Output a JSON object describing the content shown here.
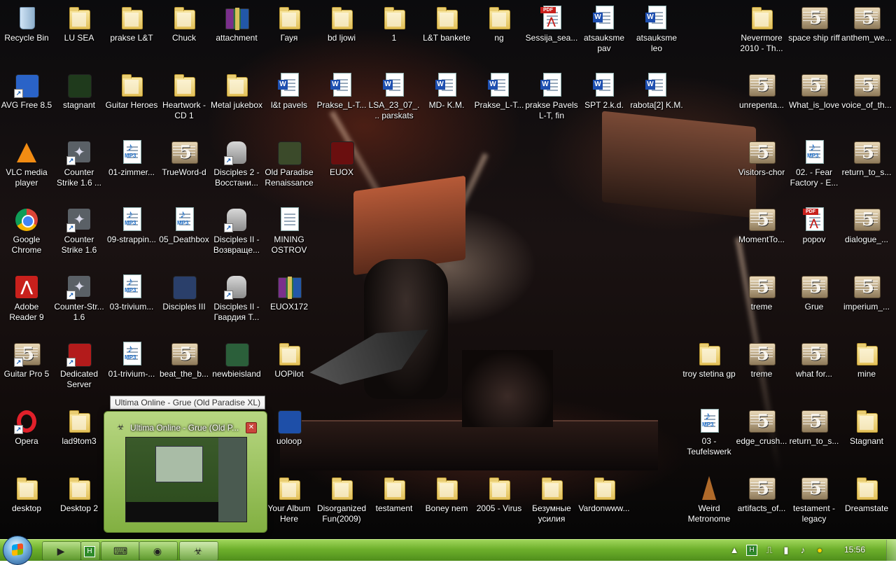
{
  "desktop": {
    "icons": [
      {
        "label": "Recycle Bin",
        "type": "recycle"
      },
      {
        "label": "LU SEA",
        "type": "folder"
      },
      {
        "label": "prakse L&T",
        "type": "folder"
      },
      {
        "label": "Chuck",
        "type": "folder"
      },
      {
        "label": "attachment",
        "type": "rar"
      },
      {
        "label": "Гауя",
        "type": "folder"
      },
      {
        "label": "bd ljowi",
        "type": "folder"
      },
      {
        "label": "1",
        "type": "folder"
      },
      {
        "label": "L&T bankete",
        "type": "folder"
      },
      {
        "label": "ng",
        "type": "folder"
      },
      {
        "label": "Sessija_sea...",
        "type": "pdf"
      },
      {
        "label": "atsauksme pav",
        "type": "word"
      },
      {
        "label": "atsauksme leo",
        "type": "word"
      },
      {
        "label": "Nevermore 2010 - Th...",
        "type": "folder"
      },
      {
        "label": "space ship riff",
        "type": "gp5"
      },
      {
        "label": "anthem_we...",
        "type": "gp5"
      },
      {
        "label": "AVG Free 8.5",
        "type": "app",
        "color": "#2a63c7",
        "shortcut": true
      },
      {
        "label": "stagnant",
        "type": "app",
        "color": "#1f3a1c"
      },
      {
        "label": "Guitar Heroes",
        "type": "folder"
      },
      {
        "label": "Heartwork - CD 1",
        "type": "folder"
      },
      {
        "label": "Metal jukebox",
        "type": "folder"
      },
      {
        "label": "l&t pavels",
        "type": "word"
      },
      {
        "label": "Prakse_L-T...",
        "type": "word"
      },
      {
        "label": "LSA_23_07_... parskats",
        "type": "word"
      },
      {
        "label": "MD- K.M.",
        "type": "word"
      },
      {
        "label": "Prakse_L-T...",
        "type": "word"
      },
      {
        "label": "prakse Pavels L-T, fin",
        "type": "word"
      },
      {
        "label": "SPT 2.k.d.",
        "type": "word"
      },
      {
        "label": "rabota[2] K.M.",
        "type": "word"
      },
      {
        "label": "unrepenta...",
        "type": "gp5"
      },
      {
        "label": "What_is_love",
        "type": "gp5"
      },
      {
        "label": "voice_of_th...",
        "type": "gp5"
      },
      {
        "label": "VLC media player",
        "type": "vlc"
      },
      {
        "label": "Counter Strike 1.6 ...",
        "type": "cs",
        "shortcut": true
      },
      {
        "label": "01-zimmer...",
        "type": "mp3"
      },
      {
        "label": "TrueWord-d",
        "type": "gp5"
      },
      {
        "label": "Disciples 2 - Восстани...",
        "type": "skull",
        "shortcut": true
      },
      {
        "label": "Old Paradise Renaissance",
        "type": "app",
        "color": "#3b4a2a"
      },
      {
        "label": "EUOX",
        "type": "app",
        "color": "#6a0f0f"
      },
      {
        "label": "Visitors-chor",
        "type": "gp5"
      },
      {
        "label": "02. - Fear Factory - E...",
        "type": "mp3"
      },
      {
        "label": "return_to_s...",
        "type": "gp5"
      },
      {
        "label": "Google Chrome",
        "type": "chrome"
      },
      {
        "label": "Counter Strike 1.6",
        "type": "cs",
        "shortcut": true
      },
      {
        "label": "09-strappin...",
        "type": "mp3"
      },
      {
        "label": "05_Deathbox",
        "type": "mp3"
      },
      {
        "label": "Disciples II - Возвраще...",
        "type": "skull",
        "shortcut": true
      },
      {
        "label": "MINING OSTROV",
        "type": "doc"
      },
      {
        "label": "MomentTo...",
        "type": "gp5"
      },
      {
        "label": "popov",
        "type": "pdf"
      },
      {
        "label": "dialogue_...",
        "type": "gp5"
      },
      {
        "label": "Adobe Reader 9",
        "type": "adobe"
      },
      {
        "label": "Counter-Str... 1.6",
        "type": "cs",
        "shortcut": true
      },
      {
        "label": "03-trivium...",
        "type": "mp3"
      },
      {
        "label": "Disciples III",
        "type": "app",
        "color": "#2a3f6a"
      },
      {
        "label": "Disciples II - Гвардия Т...",
        "type": "skull",
        "shortcut": true
      },
      {
        "label": "EUOX172",
        "type": "rar"
      },
      {
        "label": "treme",
        "type": "gp5"
      },
      {
        "label": "Grue",
        "type": "gp5"
      },
      {
        "label": "imperium_...",
        "type": "gp5"
      },
      {
        "label": "Guitar Pro 5",
        "type": "gp5",
        "shortcut": true
      },
      {
        "label": "Dedicated Server",
        "type": "app",
        "color": "#b31b1b",
        "shortcut": true
      },
      {
        "label": "01-trivium-...",
        "type": "mp3"
      },
      {
        "label": "beat_the_b...",
        "type": "gp5"
      },
      {
        "label": "newbieisland",
        "type": "app",
        "color": "#2b5f3a"
      },
      {
        "label": "UOPilot",
        "type": "folder"
      },
      {
        "label": "troy stetina gp",
        "type": "folder"
      },
      {
        "label": "treme",
        "type": "gp5"
      },
      {
        "label": "what for...",
        "type": "gp5"
      },
      {
        "label": "mine",
        "type": "folder"
      },
      {
        "label": "Opera",
        "type": "opera",
        "shortcut": true
      },
      {
        "label": "lad9tom3",
        "type": "folder"
      },
      {
        "label": "uoloop",
        "type": "app",
        "color": "#1e4fa8"
      },
      {
        "label": "03 - Teufelswerk",
        "type": "mp3"
      },
      {
        "label": "edge_crush...",
        "type": "gp5"
      },
      {
        "label": "return_to_s...",
        "type": "gp5"
      },
      {
        "label": "Stagnant",
        "type": "folder"
      },
      {
        "label": "desktop",
        "type": "folder"
      },
      {
        "label": "Desktop 2",
        "type": "folder"
      },
      {
        "label": "Your Album Here",
        "type": "folder"
      },
      {
        "label": "Disorganized Fun(2009)",
        "type": "folder"
      },
      {
        "label": "testament",
        "type": "folder"
      },
      {
        "label": "Boney nem",
        "type": "folder"
      },
      {
        "label": "2005 - Virus",
        "type": "folder"
      },
      {
        "label": "Безумные усилия",
        "type": "folder"
      },
      {
        "label": "Vardonwww...",
        "type": "folder"
      },
      {
        "label": "Weird Metronome",
        "type": "metro"
      },
      {
        "label": "artifacts_of...",
        "type": "gp5"
      },
      {
        "label": "testament - legacy",
        "type": "gp5"
      },
      {
        "label": "Dreamstate",
        "type": "folder"
      }
    ]
  },
  "tooltip": "Ultima Online - Grue (Old Paradise XL)",
  "preview": {
    "title": "Ultima Online - Grue (Old P...",
    "close_icon": "close-icon"
  },
  "taskbar": {
    "buttons": [
      {
        "name": "media-player-icon",
        "glyph": "▶"
      },
      {
        "name": "green-h-app-icon",
        "glyph": "H"
      },
      {
        "name": "keyboard-app-icon",
        "glyph": "⌨"
      },
      {
        "name": "chrome-icon",
        "glyph": "◉"
      },
      {
        "name": "ultima-online-icon",
        "glyph": "☣"
      }
    ],
    "tray": {
      "icons": [
        "show-hidden-icons-arrow",
        "green-h-tray-icon",
        "usb-device-icon",
        "network-signal-icon",
        "volume-icon",
        "messenger-icon"
      ],
      "clock": "15:56"
    }
  },
  "colors": {
    "taskbar": "#6eb02c",
    "tooltip_bg": "#f5f5f5",
    "preview_bg": "#b6dd7a"
  }
}
